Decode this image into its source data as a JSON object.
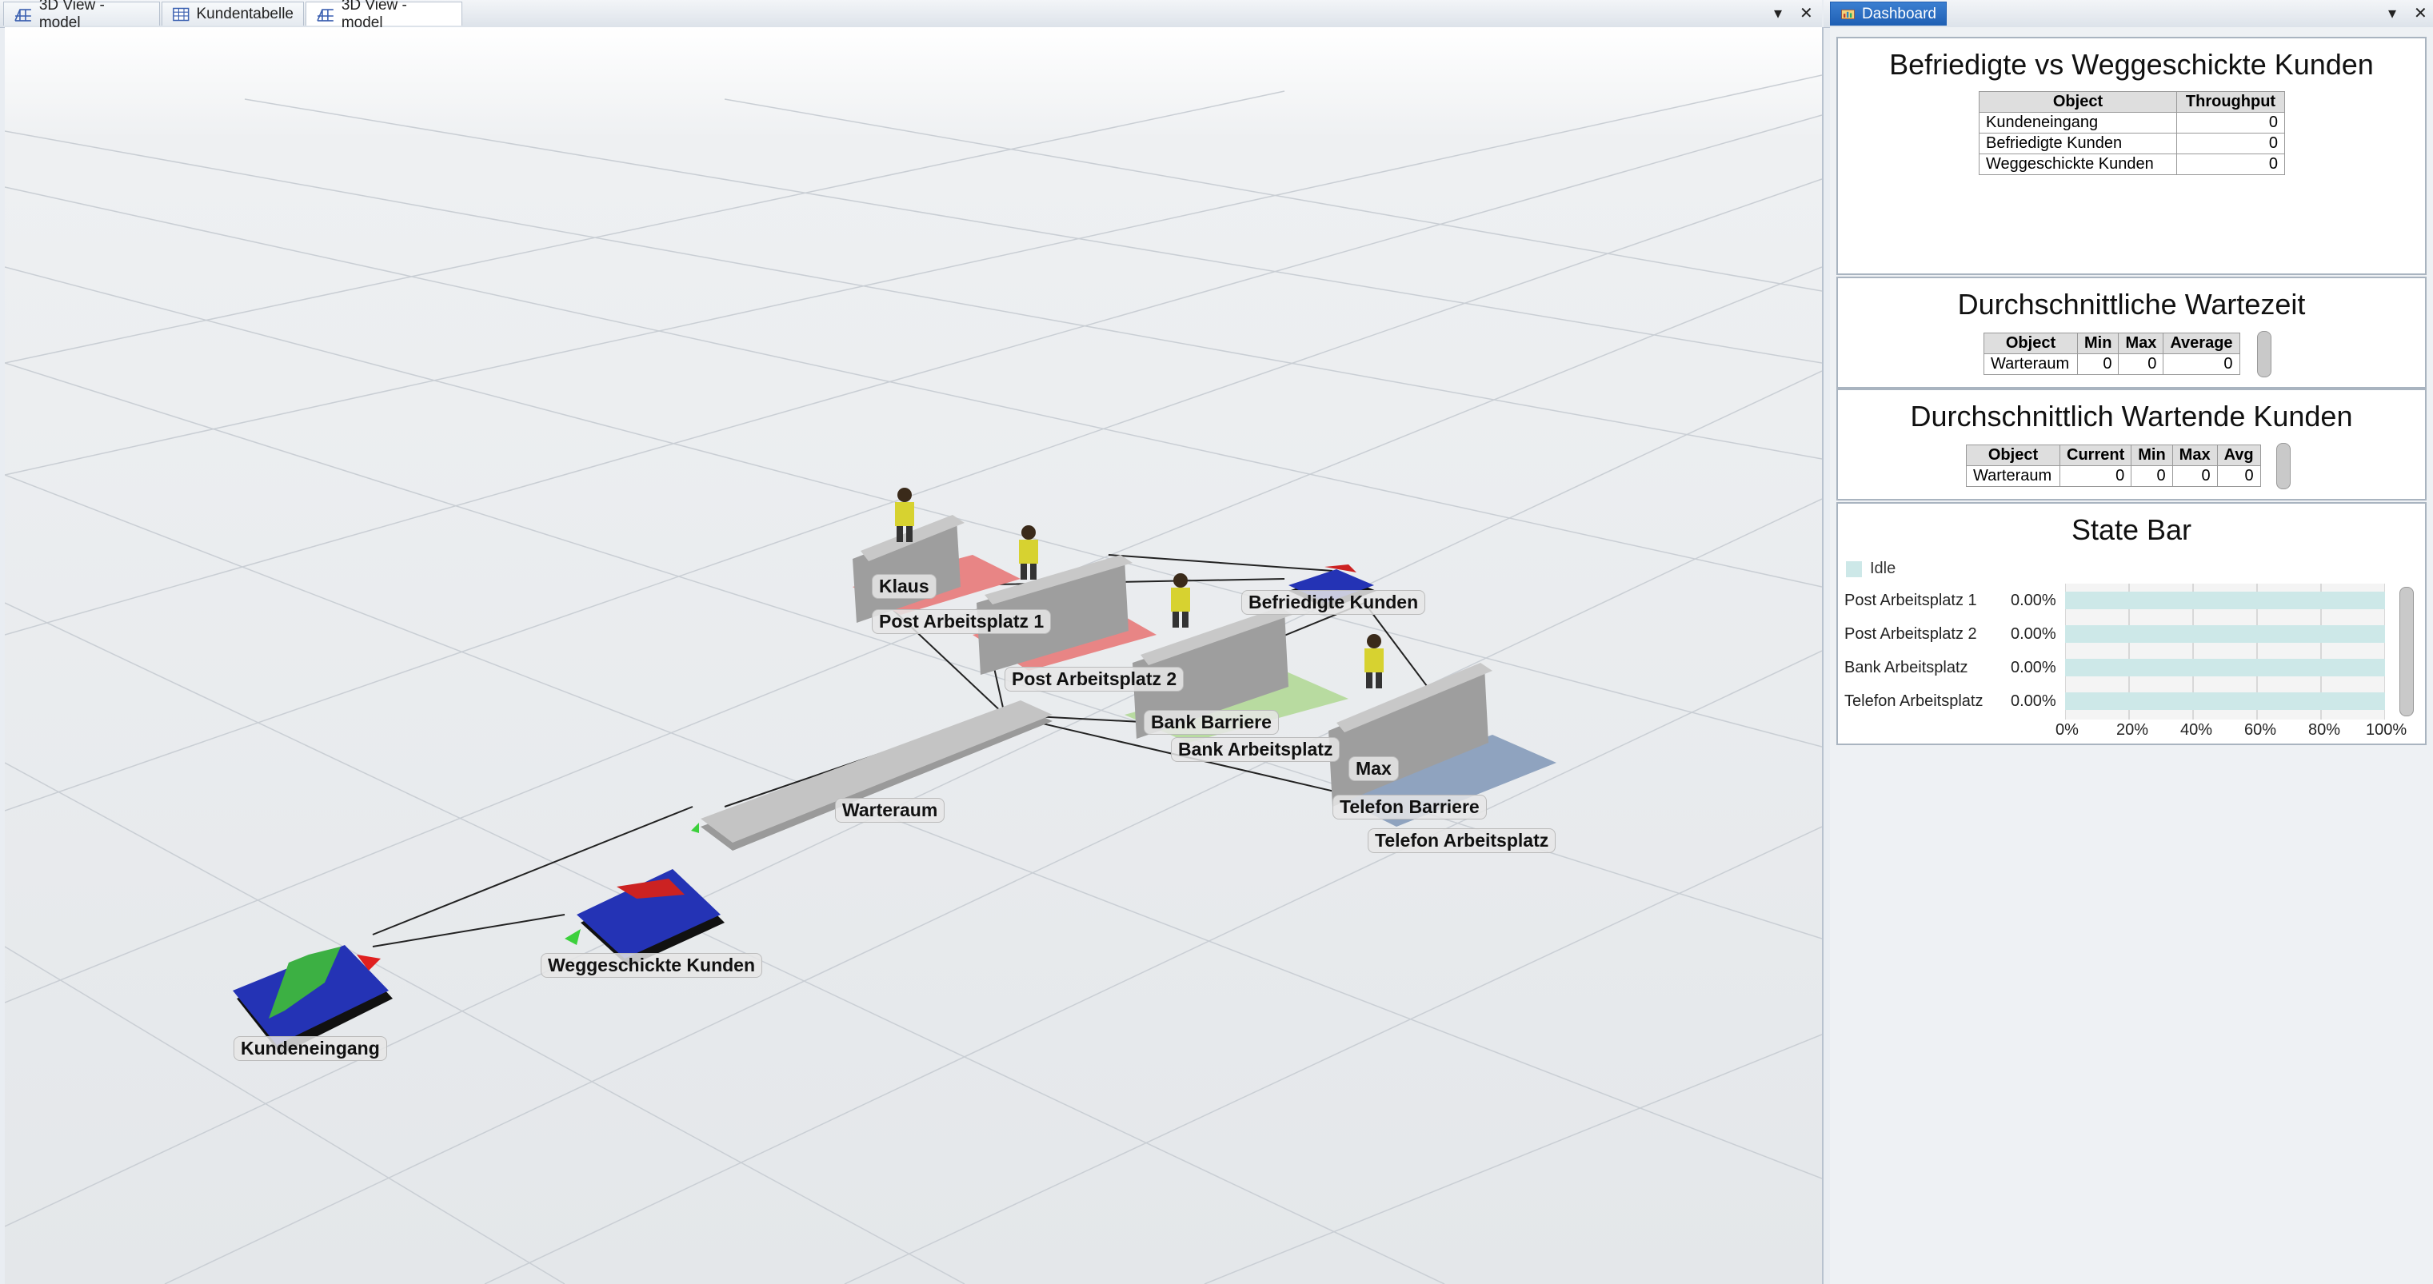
{
  "tabs_left": [
    {
      "label": "3D View - model",
      "icon": "grid-view-icon"
    },
    {
      "label": "Kundentabelle",
      "icon": "table-icon"
    },
    {
      "label": "3D View - model",
      "icon": "grid-view-icon"
    }
  ],
  "tabs_right": [
    {
      "label": "Dashboard",
      "icon": "dashboard-icon"
    }
  ],
  "view_labels": {
    "klaus": "Klaus",
    "post1": "Post Arbeitsplatz 1",
    "post2": "Post Arbeitsplatz 2",
    "befriedigte": "Befriedigte Kunden",
    "bank_barriere": "Bank Barriere",
    "bank_arbeitsplatz": "Bank Arbeitsplatz",
    "max": "Max",
    "telefon_barriere": "Telefon Barriere",
    "telefon_arbeitsplatz": "Telefon Arbeitsplatz",
    "warteraum": "Warteraum",
    "weggeschickte": "Weggeschickte Kunden",
    "kundeneingang": "Kundeneingang"
  },
  "panel1": {
    "title": "Befriedigte vs Weggeschickte Kunden",
    "headers": [
      "Object",
      "Throughput"
    ],
    "rows": [
      [
        "Kundeneingang",
        "0"
      ],
      [
        "Befriedigte Kunden",
        "0"
      ],
      [
        "Weggeschickte Kunden",
        "0"
      ]
    ]
  },
  "panel2": {
    "title": "Durchschnittliche Wartezeit",
    "headers": [
      "Object",
      "Min",
      "Max",
      "Average"
    ],
    "rows": [
      [
        "Warteraum",
        "0",
        "0",
        "0"
      ]
    ]
  },
  "panel3": {
    "title": "Durchschnittlich Wartende Kunden",
    "headers": [
      "Object",
      "Current",
      "Min",
      "Max",
      "Avg"
    ],
    "rows": [
      [
        "Warteraum",
        "0",
        "0",
        "0",
        "0"
      ]
    ]
  },
  "panel4": {
    "title": "State Bar",
    "legend": "Idle",
    "legend_color": "#cde8e8",
    "rows": [
      {
        "name": "Post Arbeitsplatz 1",
        "pct": "0.00%",
        "idle": 1.0
      },
      {
        "name": "Post Arbeitsplatz 2",
        "pct": "0.00%",
        "idle": 1.0
      },
      {
        "name": "Bank Arbeitsplatz",
        "pct": "0.00%",
        "idle": 1.0
      },
      {
        "name": "Telefon Arbeitsplatz",
        "pct": "0.00%",
        "idle": 1.0
      }
    ],
    "axis": [
      "0%",
      "20%",
      "40%",
      "60%",
      "80%",
      "100%"
    ]
  },
  "colors": {
    "accent": "#2a6fc6",
    "post_counter": "#e88585",
    "bank_counter": "#b8dba0",
    "telefon_counter": "#8fa3bf",
    "queue": "#b8b8b8",
    "pad_blue": "#2433b5"
  }
}
